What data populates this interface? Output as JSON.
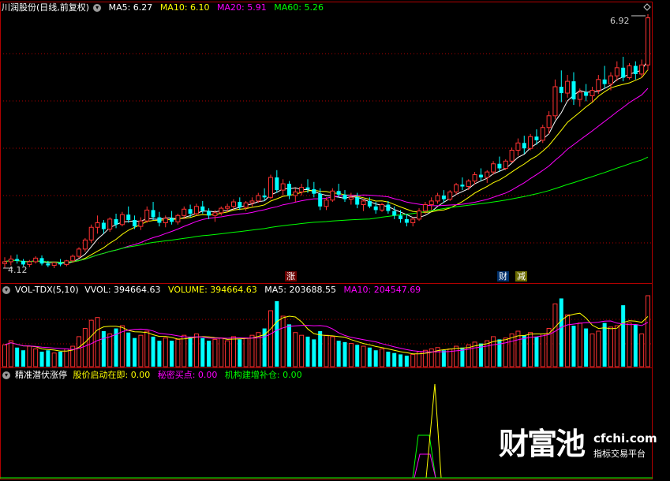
{
  "header": {
    "stock_title": "川润股份(日线,前复权)",
    "ma5": "MA5: 6.27",
    "ma10": "MA10: 6.10",
    "ma20": "MA20: 5.91",
    "ma60": "MA60: 5.26",
    "ma_colors": {
      "ma5": "#ffffff",
      "ma10": "#ffff00",
      "ma20": "#ff00ff",
      "ma60": "#00ff00"
    }
  },
  "price_chart": {
    "max_label": "6.92",
    "min_label": "4.12",
    "markers": {
      "zhang": "涨",
      "cai": "财",
      "jian": "减"
    }
  },
  "volume_panel": {
    "indicator": "VOL-TDX(5,10)",
    "vvol": "VVOL: 394664.63",
    "volume": "VOLUME: 394664.63",
    "ma5": "MA5: 203688.55",
    "ma10": "MA10: 204547.69"
  },
  "signal_panel": {
    "indicator": "精准潜伏涨停",
    "s1": "股价启动在即: 0.00",
    "s2": "秘密买点: 0.00",
    "s3": "机构建增补仓: 0.00"
  },
  "watermark": {
    "brand": "财富池",
    "url": "cfchi.com",
    "tagline": "指标交易平台"
  },
  "colors": {
    "up": "#ff3232",
    "down": "#00ffff",
    "frame": "#b00000",
    "bg": "#000000"
  },
  "chart_data": [
    {
      "type": "candlestick",
      "title": "川润股份(日线,前复权)",
      "ohlc": [
        [
          4.17,
          4.24,
          4.12,
          4.19
        ],
        [
          4.19,
          4.26,
          4.15,
          4.22
        ],
        [
          4.22,
          4.27,
          4.17,
          4.2
        ],
        [
          4.2,
          4.22,
          4.14,
          4.16
        ],
        [
          4.16,
          4.21,
          4.13,
          4.19
        ],
        [
          4.19,
          4.25,
          4.17,
          4.23
        ],
        [
          4.23,
          4.26,
          4.15,
          4.17
        ],
        [
          4.17,
          4.2,
          4.13,
          4.15
        ],
        [
          4.15,
          4.19,
          4.12,
          4.18
        ],
        [
          4.18,
          4.22,
          4.14,
          4.16
        ],
        [
          4.16,
          4.21,
          4.14,
          4.2
        ],
        [
          4.2,
          4.27,
          4.18,
          4.25
        ],
        [
          4.25,
          4.35,
          4.23,
          4.33
        ],
        [
          4.33,
          4.45,
          4.3,
          4.43
        ],
        [
          4.43,
          4.6,
          4.4,
          4.57
        ],
        [
          4.57,
          4.7,
          4.5,
          4.62
        ],
        [
          4.62,
          4.65,
          4.5,
          4.55
        ],
        [
          4.55,
          4.68,
          4.52,
          4.66
        ],
        [
          4.66,
          4.72,
          4.56,
          4.6
        ],
        [
          4.6,
          4.74,
          4.58,
          4.71
        ],
        [
          4.71,
          4.8,
          4.62,
          4.65
        ],
        [
          4.65,
          4.7,
          4.55,
          4.58
        ],
        [
          4.58,
          4.68,
          4.54,
          4.64
        ],
        [
          4.64,
          4.8,
          4.62,
          4.76
        ],
        [
          4.76,
          4.85,
          4.65,
          4.68
        ],
        [
          4.68,
          4.74,
          4.58,
          4.62
        ],
        [
          4.62,
          4.7,
          4.57,
          4.67
        ],
        [
          4.67,
          4.75,
          4.6,
          4.63
        ],
        [
          4.63,
          4.72,
          4.6,
          4.7
        ],
        [
          4.7,
          4.8,
          4.66,
          4.77
        ],
        [
          4.77,
          4.82,
          4.68,
          4.72
        ],
        [
          4.72,
          4.83,
          4.7,
          4.8
        ],
        [
          4.8,
          4.86,
          4.72,
          4.75
        ],
        [
          4.75,
          4.78,
          4.66,
          4.7
        ],
        [
          4.7,
          4.76,
          4.63,
          4.73
        ],
        [
          4.73,
          4.8,
          4.7,
          4.78
        ],
        [
          4.78,
          4.83,
          4.74,
          4.8
        ],
        [
          4.8,
          4.88,
          4.77,
          4.85
        ],
        [
          4.85,
          4.9,
          4.76,
          4.79
        ],
        [
          4.79,
          4.86,
          4.75,
          4.84
        ],
        [
          4.84,
          4.9,
          4.8,
          4.86
        ],
        [
          4.86,
          4.95,
          4.84,
          4.92
        ],
        [
          4.92,
          5.0,
          4.86,
          4.9
        ],
        [
          4.9,
          5.15,
          4.88,
          5.12
        ],
        [
          5.12,
          5.2,
          4.95,
          4.98
        ],
        [
          4.98,
          5.1,
          4.92,
          5.05
        ],
        [
          5.05,
          5.08,
          4.88,
          4.92
        ],
        [
          4.92,
          5.0,
          4.85,
          4.96
        ],
        [
          4.96,
          5.05,
          4.92,
          5.01
        ],
        [
          5.01,
          5.1,
          4.95,
          4.99
        ],
        [
          4.99,
          5.07,
          4.9,
          4.94
        ],
        [
          4.94,
          5.0,
          4.76,
          4.8
        ],
        [
          4.8,
          4.9,
          4.76,
          4.87
        ],
        [
          4.87,
          5.0,
          4.85,
          4.97
        ],
        [
          4.97,
          5.05,
          4.9,
          4.93
        ],
        [
          4.93,
          4.98,
          4.85,
          4.88
        ],
        [
          4.88,
          4.95,
          4.82,
          4.9
        ],
        [
          4.9,
          4.95,
          4.78,
          4.82
        ],
        [
          4.82,
          4.88,
          4.75,
          4.86
        ],
        [
          4.86,
          4.9,
          4.78,
          4.8
        ],
        [
          4.8,
          4.85,
          4.72,
          4.76
        ],
        [
          4.76,
          4.84,
          4.74,
          4.82
        ],
        [
          4.82,
          4.86,
          4.72,
          4.75
        ],
        [
          4.75,
          4.8,
          4.66,
          4.7
        ],
        [
          4.7,
          4.76,
          4.62,
          4.66
        ],
        [
          4.66,
          4.72,
          4.58,
          4.62
        ],
        [
          4.62,
          4.68,
          4.58,
          4.66
        ],
        [
          4.66,
          4.78,
          4.64,
          4.75
        ],
        [
          4.75,
          4.85,
          4.72,
          4.82
        ],
        [
          4.82,
          4.9,
          4.76,
          4.86
        ],
        [
          4.86,
          4.95,
          4.83,
          4.92
        ],
        [
          4.92,
          4.98,
          4.84,
          4.88
        ],
        [
          4.88,
          4.98,
          4.86,
          4.96
        ],
        [
          4.96,
          5.06,
          4.93,
          5.04
        ],
        [
          5.04,
          5.12,
          4.98,
          5.02
        ],
        [
          5.02,
          5.1,
          4.98,
          5.08
        ],
        [
          5.08,
          5.18,
          5.04,
          5.15
        ],
        [
          5.15,
          5.22,
          5.08,
          5.12
        ],
        [
          5.12,
          5.2,
          5.06,
          5.18
        ],
        [
          5.18,
          5.3,
          5.15,
          5.27
        ],
        [
          5.27,
          5.35,
          5.18,
          5.22
        ],
        [
          5.22,
          5.32,
          5.2,
          5.3
        ],
        [
          5.3,
          5.45,
          5.28,
          5.42
        ],
        [
          5.42,
          5.55,
          5.36,
          5.5
        ],
        [
          5.5,
          5.58,
          5.38,
          5.44
        ],
        [
          5.44,
          5.6,
          5.42,
          5.57
        ],
        [
          5.57,
          5.65,
          5.48,
          5.53
        ],
        [
          5.53,
          5.7,
          5.5,
          5.67
        ],
        [
          5.67,
          5.85,
          5.6,
          5.8
        ],
        [
          5.8,
          6.2,
          5.76,
          6.12
        ],
        [
          6.12,
          6.3,
          5.95,
          6.05
        ],
        [
          6.05,
          6.25,
          6.0,
          6.18
        ],
        [
          6.18,
          6.28,
          5.92,
          5.98
        ],
        [
          5.98,
          6.1,
          5.9,
          6.06
        ],
        [
          6.06,
          6.15,
          5.96,
          6.02
        ],
        [
          6.02,
          6.12,
          5.95,
          6.08
        ],
        [
          6.08,
          6.25,
          6.04,
          6.2
        ],
        [
          6.2,
          6.35,
          6.1,
          6.15
        ],
        [
          6.15,
          6.28,
          6.08,
          6.24
        ],
        [
          6.24,
          6.4,
          6.18,
          6.33
        ],
        [
          6.33,
          6.45,
          6.18,
          6.22
        ],
        [
          6.22,
          6.38,
          6.2,
          6.35
        ],
        [
          6.35,
          6.4,
          6.2,
          6.26
        ],
        [
          6.26,
          6.42,
          6.22,
          6.36
        ],
        [
          6.36,
          6.92,
          6.3,
          6.88
        ]
      ],
      "ma_colors": [
        "#ffffff",
        "#ffff00",
        "#ff00ff",
        "#00ff00"
      ]
    },
    {
      "type": "bar",
      "title": "VOL-TDX(5,10)",
      "values": [
        80,
        95,
        70,
        60,
        75,
        65,
        55,
        60,
        50,
        55,
        65,
        75,
        110,
        140,
        170,
        180,
        130,
        120,
        140,
        150,
        125,
        105,
        115,
        130,
        110,
        95,
        105,
        95,
        100,
        115,
        110,
        120,
        105,
        95,
        100,
        105,
        95,
        110,
        100,
        105,
        115,
        125,
        140,
        205,
        240,
        185,
        155,
        125,
        115,
        110,
        100,
        130,
        115,
        110,
        95,
        90,
        85,
        80,
        75,
        70,
        60,
        65,
        55,
        50,
        45,
        40,
        45,
        55,
        60,
        65,
        70,
        60,
        65,
        75,
        70,
        80,
        90,
        85,
        95,
        110,
        100,
        105,
        120,
        130,
        115,
        125,
        110,
        120,
        140,
        230,
        250,
        190,
        150,
        160,
        140,
        120,
        130,
        160,
        145,
        150,
        225,
        160,
        155,
        120,
        260
      ]
    }
  ]
}
